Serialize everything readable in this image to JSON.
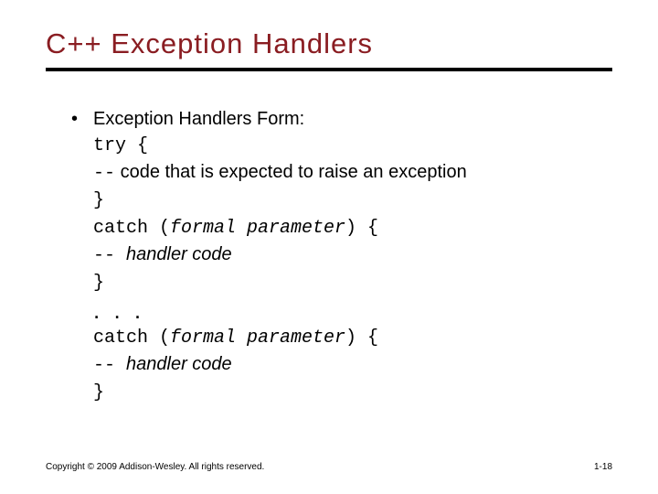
{
  "title": "C++ Exception Handlers",
  "bullet": {
    "dot": "•",
    "text": "Exception Handlers Form:"
  },
  "code": {
    "l1": "try {",
    "l2a": "--",
    "l2b": " code that is expected to raise an exception",
    "l3": "}",
    "l4a": "catch (",
    "l4b": "formal parameter",
    "l4c": ") {",
    "l5a": "-- ",
    "l5b": "handler code",
    "l6": "}",
    "dots": ". . .",
    "l7a": "catch (",
    "l7b": "formal parameter",
    "l7c": ") {",
    "l8a": "-- ",
    "l8b": "handler code",
    "l9": "}"
  },
  "footer": "Copyright © 2009 Addison-Wesley. All rights reserved.",
  "pagenum": "1-18"
}
